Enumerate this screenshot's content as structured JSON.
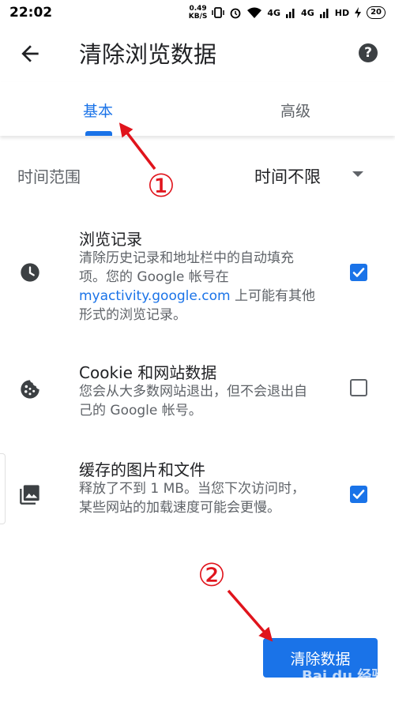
{
  "status_bar": {
    "time": "22:02",
    "net_speed_value": "0.49",
    "net_speed_unit": "KB/S",
    "signal_1": "4G",
    "signal_2": "4G",
    "hd": "HD",
    "battery": "20"
  },
  "header": {
    "title": "清除浏览数据",
    "back_icon": "arrow-left-icon",
    "help_label": "?"
  },
  "tabs": [
    {
      "label": "基本",
      "active": true
    },
    {
      "label": "高级",
      "active": false
    }
  ],
  "time_range": {
    "label": "时间范围",
    "value": "时间不限"
  },
  "options": [
    {
      "icon": "clock-icon",
      "title": "浏览记录",
      "desc_before_link": "清除历史记录和地址栏中的自动填充项。您的 Google 帐号在 ",
      "desc_link": "myactivity.google.com",
      "desc_after_link": " 上可能有其他形式的浏览记录。",
      "checked": true
    },
    {
      "icon": "cookie-icon",
      "title": "Cookie 和网站数据",
      "desc": "您会从大多数网站退出，但不会退出自己的 Google 帐号。",
      "checked": false
    },
    {
      "icon": "image-icon",
      "title": "缓存的图片和文件",
      "desc": "释放了不到 1 MB。当您下次访问时，某些网站的加载速度可能会更慢。",
      "checked": true
    }
  ],
  "clear_button": {
    "label": "清除数据"
  },
  "annotations": {
    "first": "①",
    "second": "②"
  },
  "watermark": "Bai du 经验",
  "colors": {
    "accent": "#1a73e8",
    "annotation": "#e0141c"
  }
}
